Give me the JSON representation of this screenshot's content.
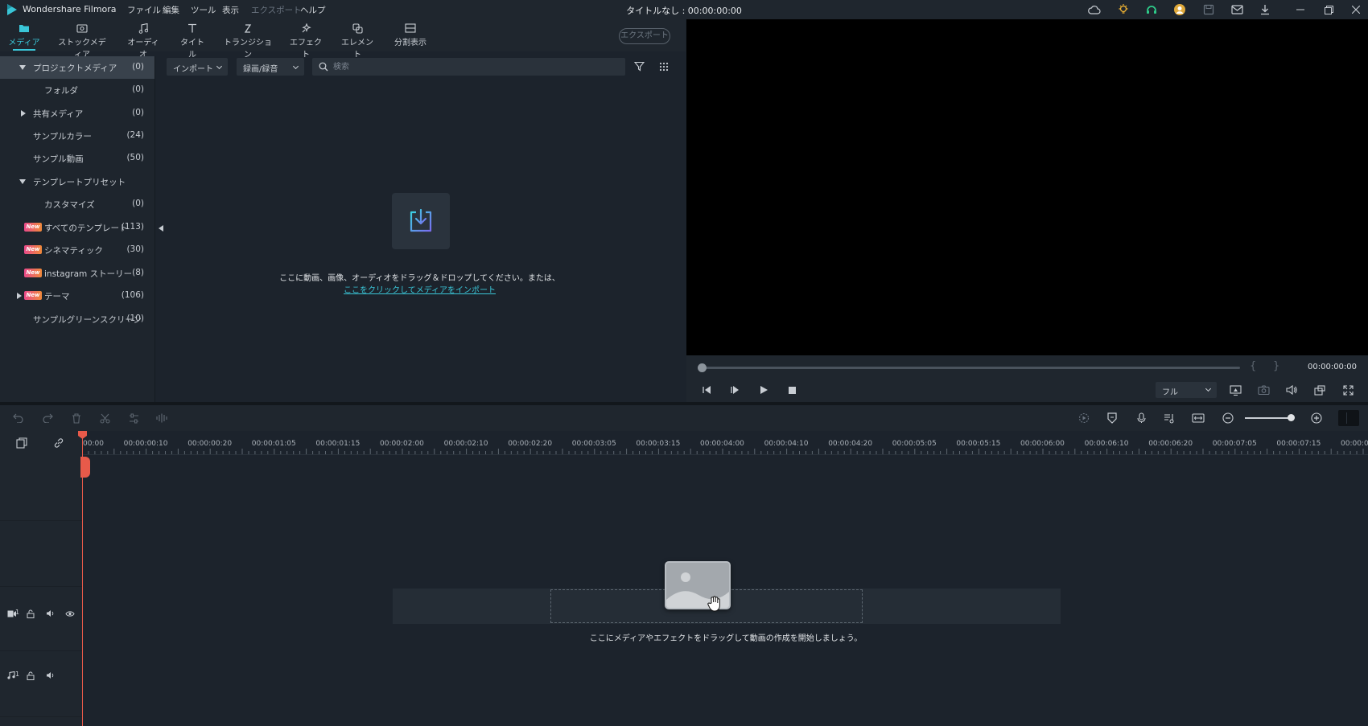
{
  "app": {
    "name": "Wondershare Filmora",
    "doc_title": "タイトルなし : 00:00:00:00"
  },
  "menu": [
    {
      "label": "ファイル",
      "disabled": false
    },
    {
      "label": "編集",
      "disabled": false
    },
    {
      "label": "ツール",
      "disabled": false
    },
    {
      "label": "表示",
      "disabled": false
    },
    {
      "label": "エクスポート",
      "disabled": true
    },
    {
      "label": "ヘルプ",
      "disabled": false
    }
  ],
  "tabs": [
    {
      "label": "メディア",
      "icon": "folder-icon",
      "active": true
    },
    {
      "label": "ストックメディア",
      "icon": "stock-media-icon",
      "active": false
    },
    {
      "label": "オーディオ",
      "icon": "music-note-icon",
      "active": false
    },
    {
      "label": "タイトル",
      "icon": "text-t-icon",
      "active": false
    },
    {
      "label": "トランジション",
      "icon": "transition-icon",
      "active": false
    },
    {
      "label": "エフェクト",
      "icon": "effect-sparkle-icon",
      "active": false
    },
    {
      "label": "エレメント",
      "icon": "element-icon",
      "active": false
    },
    {
      "label": "分割表示",
      "icon": "split-screen-icon",
      "active": false
    }
  ],
  "export_button": "エクスポート",
  "sidebar": {
    "items": [
      {
        "label": "プロジェクトメディア",
        "count": "(0)",
        "arrow": "down",
        "selected": true,
        "new": false
      },
      {
        "label": "フォルダ",
        "count": "(0)",
        "arrow": "",
        "selected": false,
        "new": false
      },
      {
        "label": "共有メディア",
        "count": "(0)",
        "arrow": "right",
        "selected": false,
        "new": false
      },
      {
        "label": "サンプルカラー",
        "count": "(24)",
        "arrow": "",
        "selected": false,
        "new": false
      },
      {
        "label": "サンプル動画",
        "count": "(50)",
        "arrow": "",
        "selected": false,
        "new": false
      },
      {
        "label": "テンプレートプリセット",
        "count": "",
        "arrow": "down",
        "selected": false,
        "new": false
      },
      {
        "label": "カスタマイズ",
        "count": "(0)",
        "arrow": "",
        "selected": false,
        "new": false
      },
      {
        "label": "すべてのテンプレート",
        "count": "(113)",
        "arrow": "",
        "selected": false,
        "new": true
      },
      {
        "label": "シネマティック",
        "count": "(30)",
        "arrow": "",
        "selected": false,
        "new": true
      },
      {
        "label": "instagram ストーリー",
        "count": "(8)",
        "arrow": "",
        "selected": false,
        "new": true
      },
      {
        "label": "テーマ",
        "count": "(106)",
        "arrow": "right",
        "selected": false,
        "new": true
      },
      {
        "label": "サンプルグリーンスクリーン",
        "count": "(10)",
        "arrow": "",
        "selected": false,
        "new": false
      }
    ],
    "new_badge": "New"
  },
  "media": {
    "import_dropdown": "インポート",
    "record_dropdown": "録画/録音",
    "search_placeholder": "検索",
    "drop_hint": "ここに動画、画像、オーディオをドラッグ＆ドロップしてください。または、",
    "drop_link": "ここをクリックしてメディアをインポート"
  },
  "preview": {
    "timecode": "00:00:00:00",
    "quality": "フル",
    "brace_in": "{",
    "brace_out": "}"
  },
  "timeline": {
    "ruler_labels": [
      "00:00",
      "00:00:00:10",
      "00:00:00:20",
      "00:00:01:05",
      "00:00:01:15",
      "00:00:02:00",
      "00:00:02:10",
      "00:00:02:20",
      "00:00:03:05",
      "00:00:03:15",
      "00:00:04:00",
      "00:00:04:10",
      "00:00:04:20",
      "00:00:05:05",
      "00:00:05:15",
      "00:00:06:00",
      "00:00:06:10",
      "00:00:06:20",
      "00:00:07:05",
      "00:00:07:15",
      "00:00:0"
    ],
    "video_track_num": "1",
    "audio_track_num": "1",
    "drop_hint": "ここにメディアやエフェクトをドラッグして動画の作成を開始しましょう。",
    "zoom_level": 0.9
  },
  "colors": {
    "accent": "#3ac6d8",
    "playhead": "#e85a4a",
    "background": "#1c232c",
    "panel": "#1f262e"
  }
}
